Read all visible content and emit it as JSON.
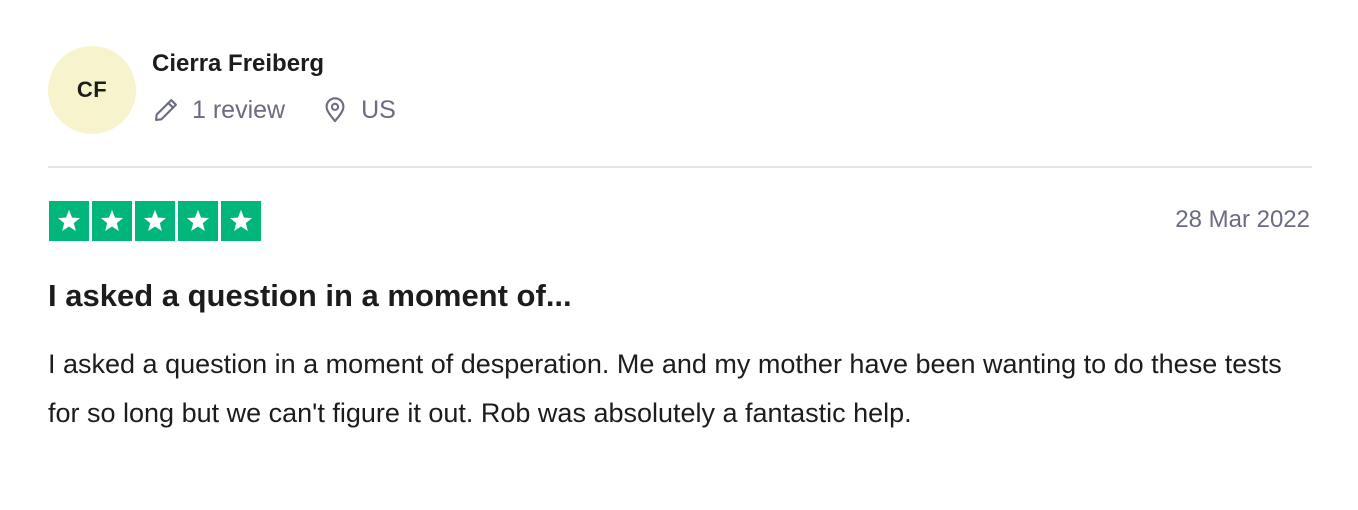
{
  "reviewer": {
    "initials": "CF",
    "name": "Cierra Freiberg",
    "review_count": "1 review",
    "country": "US"
  },
  "review": {
    "rating": 5,
    "rating_max": 5,
    "date": "28 Mar 2022",
    "title": "I asked a question in a moment of...",
    "text": "I asked a question in a moment of desperation. Me and my mother have been wanting to do these tests for so long but we can't figure it out. Rob was absolutely a fantastic help."
  },
  "colors": {
    "star_background": "#00b67a",
    "avatar_background": "#f7f3cd",
    "muted_text": "#6b6b83"
  },
  "icons": {
    "reviews": "pencil-icon",
    "location": "location-pin-icon",
    "star": "star-icon"
  }
}
